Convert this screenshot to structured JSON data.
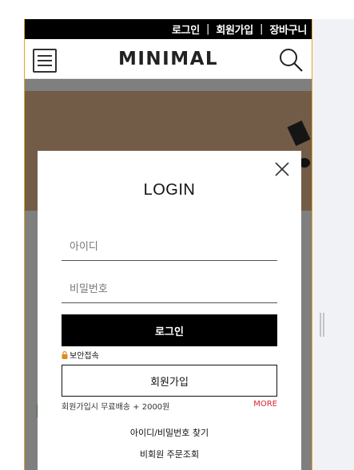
{
  "topbar": {
    "login": "로그인",
    "signup": "회원가입",
    "cart": "장바구니",
    "separator": "|"
  },
  "header": {
    "logo": "MINIMAL",
    "menu_icon": "hamburger-icon",
    "search_icon": "search-icon"
  },
  "modal": {
    "title": "LOGIN",
    "close_icon": "close-icon",
    "id_placeholder": "아이디",
    "password_placeholder": "비밀번호",
    "login_button": "로그인",
    "secure_label": "보안접속",
    "secure_icon": "lock-icon",
    "join_button": "회원가입",
    "join_note": "회원가입시 무료배송 + 2000원",
    "more_link": "MORE",
    "find_link": "아이디/비밀번호 찾기",
    "guest_order_link": "비회원 주문조회"
  },
  "colors": {
    "topbar_bg": "#000000",
    "accent_border": "#e0a72a",
    "more_link": "#d8242f",
    "overlay": "rgba(0,0,0,0.5)",
    "secure_icon": "#e08a1e",
    "tag_green": "#7fbf6a",
    "tag_red": "#e05a4a",
    "tag_tan": "#c8a27a"
  }
}
